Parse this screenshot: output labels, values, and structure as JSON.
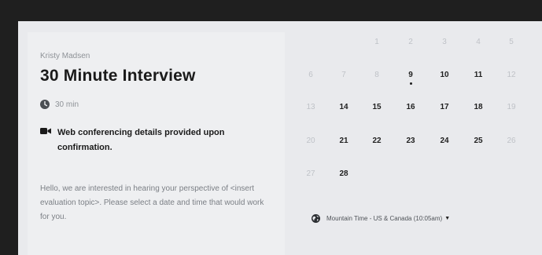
{
  "event": {
    "organizer": "Kristy Madsen",
    "title": "30 Minute Interview",
    "duration": "30 min",
    "conferencing": "Web conferencing details provided upon confirmation.",
    "description": "Hello, we are interested in hearing your perspective of <insert evaluation topic>. Please select a date and time that would work for you."
  },
  "calendar": {
    "weeks": [
      [
        {
          "day": "1",
          "available": false
        },
        {
          "day": "2",
          "available": false
        },
        {
          "day": "3",
          "available": false
        },
        {
          "day": "4",
          "available": false
        },
        {
          "day": "5",
          "available": false
        }
      ],
      [
        {
          "day": "6",
          "available": false
        },
        {
          "day": "7",
          "available": false
        },
        {
          "day": "8",
          "available": false
        },
        {
          "day": "9",
          "available": true,
          "today": true
        },
        {
          "day": "10",
          "available": true
        },
        {
          "day": "11",
          "available": true
        },
        {
          "day": "12",
          "available": false
        }
      ],
      [
        {
          "day": "13",
          "available": false
        },
        {
          "day": "14",
          "available": true
        },
        {
          "day": "15",
          "available": true
        },
        {
          "day": "16",
          "available": true
        },
        {
          "day": "17",
          "available": true
        },
        {
          "day": "18",
          "available": true
        },
        {
          "day": "19",
          "available": false
        }
      ],
      [
        {
          "day": "20",
          "available": false
        },
        {
          "day": "21",
          "available": true
        },
        {
          "day": "22",
          "available": true
        },
        {
          "day": "23",
          "available": true
        },
        {
          "day": "24",
          "available": true
        },
        {
          "day": "25",
          "available": true
        },
        {
          "day": "26",
          "available": false
        }
      ],
      [
        {
          "day": "27",
          "available": false
        },
        {
          "day": "28",
          "available": true
        }
      ]
    ]
  },
  "timezone": {
    "label": "Mountain Time - US & Canada (10:05am)"
  },
  "icons": {
    "duration": "clock-icon",
    "conferencing": "video-camera-icon",
    "timezone": "globe-icon",
    "timezone_dropdown": "caret-down-icon"
  },
  "colors": {
    "background": "#1f1f1f",
    "panel": "#e9eaed",
    "details_card": "#eeeff1",
    "available_day": "#1f1f1f",
    "unavailable_day": "#bfc2c7"
  }
}
